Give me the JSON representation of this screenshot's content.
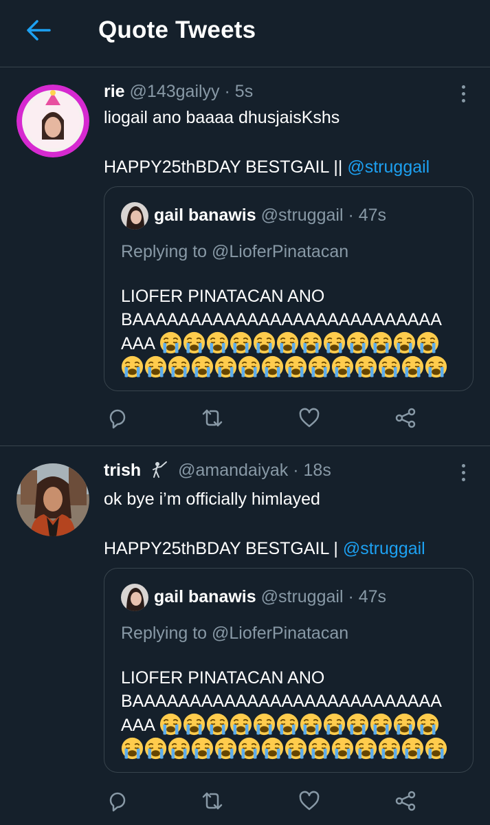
{
  "header": {
    "title": "Quote Tweets"
  },
  "colors": {
    "background": "#15202b",
    "accent": "#1da1f2",
    "muted": "#8899a6",
    "border": "#38444d"
  },
  "tweets": [
    {
      "name": "rie",
      "handle": "@143gailyy",
      "time": "5s",
      "text_line1": "liogail ano baaaa dhusjaisKshs",
      "text_line2": "HAPPY25thBDAY BESTGAIL ||",
      "mention": "@struggail",
      "quote": {
        "name": "gail banawis",
        "handle": "@struggail",
        "time": "47s",
        "reply": "Replying to @LioferPinatacan",
        "body_line1": "LIOFER PINATACAN ANO",
        "body_line2": "BAAAAAAAAAAAAAAAAAAAAAAAAAAA",
        "body_line3": "AAA",
        "emoji_icon": "loudly-crying-face-icon",
        "emoji_count_row1": 12,
        "emoji_count_row2": 14
      }
    },
    {
      "name": "trish",
      "handle": "@amandaiyak",
      "time": "18s",
      "name_icon": "fencer-icon",
      "text_line1": "ok bye i’m officially himlayed",
      "text_line2": "HAPPY25thBDAY BESTGAIL |",
      "mention": "@struggail",
      "quote": {
        "name": "gail banawis",
        "handle": "@struggail",
        "time": "47s",
        "reply": "Replying to @LioferPinatacan",
        "body_line1": "LIOFER PINATACAN ANO",
        "body_line2": "BAAAAAAAAAAAAAAAAAAAAAAAAAAA",
        "body_line3": "AAA",
        "emoji_icon": "loudly-crying-face-icon",
        "emoji_count_row1": 12,
        "emoji_count_row2": 14
      }
    }
  ],
  "action_icons": [
    "reply-icon",
    "retweet-icon",
    "like-icon",
    "share-icon"
  ]
}
